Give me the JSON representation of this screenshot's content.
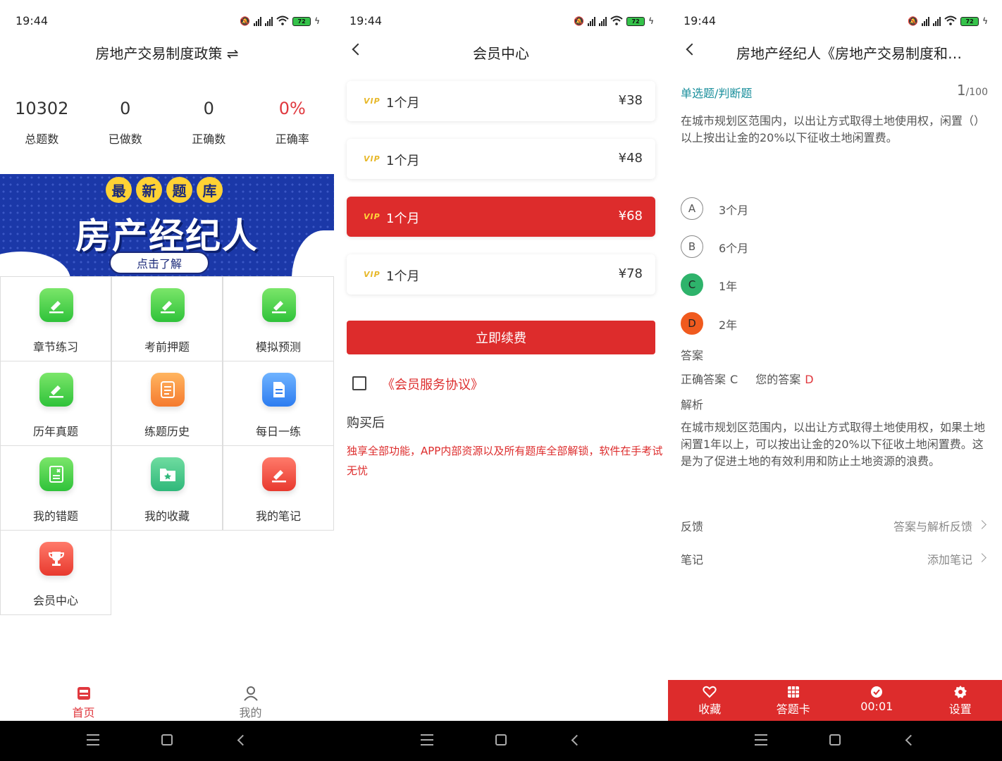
{
  "status": {
    "time": "19:44",
    "network": "5G",
    "battery": "72"
  },
  "home": {
    "title": "房地产交易制度政策 ⇌",
    "stats": [
      {
        "value": "10302",
        "label": "总题数"
      },
      {
        "value": "0",
        "label": "已做数"
      },
      {
        "value": "0",
        "label": "正确数"
      },
      {
        "value": "0%",
        "label": "正确率"
      }
    ],
    "banner": {
      "badges": [
        "最",
        "新",
        "题",
        "库"
      ],
      "headline": "房产经纪人",
      "button": "点击了解"
    },
    "grid": [
      {
        "label": "章节练习",
        "icon": "edit-icon"
      },
      {
        "label": "考前押题",
        "icon": "edit-icon"
      },
      {
        "label": "模拟预测",
        "icon": "edit-icon"
      },
      {
        "label": "历年真题",
        "icon": "edit-icon"
      },
      {
        "label": "练题历史",
        "icon": "history-icon"
      },
      {
        "label": "每日一练",
        "icon": "document-icon"
      },
      {
        "label": "我的错题",
        "icon": "wrong-book-icon"
      },
      {
        "label": "我的收藏",
        "icon": "star-folder-icon"
      },
      {
        "label": "我的笔记",
        "icon": "note-pen-icon"
      },
      {
        "label": "会员中心",
        "icon": "trophy-icon"
      }
    ],
    "tabs": [
      {
        "label": "首页",
        "icon": "home-100-icon"
      },
      {
        "label": "我的",
        "icon": "user-icon"
      }
    ]
  },
  "member": {
    "title": "会员中心",
    "plans": [
      {
        "vip": "VIP",
        "name": "1个月",
        "price": "¥38"
      },
      {
        "vip": "VIP",
        "name": "1个月",
        "price": "¥48"
      },
      {
        "vip": "VIP",
        "name": "1个月",
        "price": "¥68"
      },
      {
        "vip": "VIP",
        "name": "1个月",
        "price": "¥78"
      }
    ],
    "renew_button": "立即续费",
    "agreement": "《会员服务协议》",
    "after_label": "购买后",
    "after_text": "独享全部功能，APP内部资源以及所有题库全部解锁，软件在手考试无忧"
  },
  "question": {
    "title": "房地产经纪人《房地产交易制度和…",
    "type": "单选题/判断题",
    "number": "1",
    "total": "/100",
    "text": "在城市规划区范围内，以出让方式取得土地使用权，闲置（）以上按出让金的20%以下征收土地闲置费。",
    "options": [
      {
        "letter": "A",
        "text": "3个月"
      },
      {
        "letter": "B",
        "text": "6个月"
      },
      {
        "letter": "C",
        "text": "1年"
      },
      {
        "letter": "D",
        "text": "2年"
      }
    ],
    "answer_label": "答案",
    "correct_label": "正确答案",
    "correct_value": "C",
    "your_label": "您的答案",
    "your_value": "D",
    "analysis_label": "解析",
    "analysis": "在城市规划区范围内，以出让方式取得土地使用权，如果土地闲置1年以上，可以按出让金的20%以下征收土地闲置费。这是为了促进土地的有效利用和防止土地资源的浪费。",
    "feedback_label": "反馈",
    "feedback_value": "答案与解析反馈",
    "note_label": "笔记",
    "note_value": "添加笔记",
    "bottom": [
      {
        "label": "收藏",
        "icon": "heart-icon"
      },
      {
        "label": "答题卡",
        "icon": "grid-card-icon"
      },
      {
        "label": "00:01",
        "icon": "clock-icon"
      },
      {
        "label": "设置",
        "icon": "gear-icon"
      }
    ]
  }
}
